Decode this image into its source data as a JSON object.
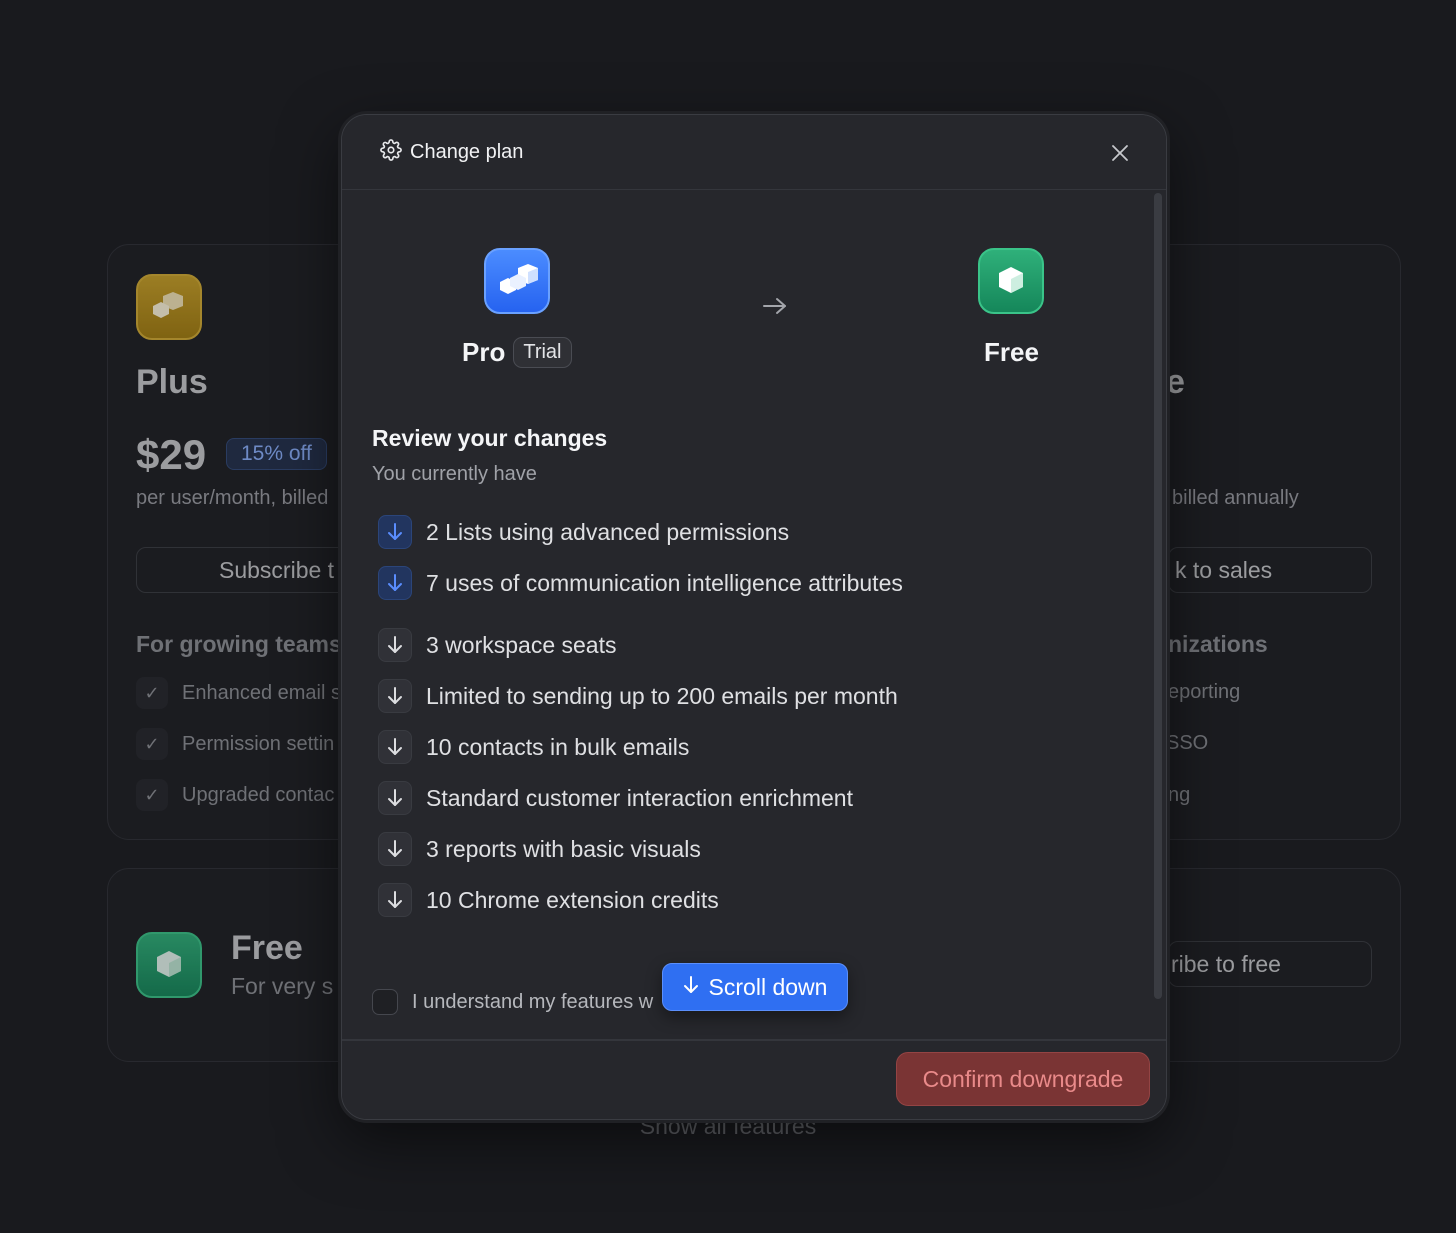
{
  "background": {
    "plus": {
      "title": "Plus",
      "price": "$29",
      "discount": "15% off",
      "per": "per user/month, billed",
      "subscribe_label": "Subscribe t",
      "for_label": "For growing teams",
      "features": [
        "Enhanced email s",
        "Permission settin",
        "Upgraded contac"
      ]
    },
    "right": {
      "title_fragment": "e",
      "billed": "billed annually",
      "sales_label": "k to sales",
      "org_label": "nizations",
      "features": [
        "eporting",
        "SSO",
        "ng"
      ]
    },
    "free": {
      "title": "Free",
      "subtitle": "For very s",
      "button_label": "ribe to free"
    },
    "show_all": "Show all features"
  },
  "modal": {
    "title": "Change plan",
    "from_plan": {
      "name": "Pro",
      "badge": "Trial"
    },
    "to_plan": {
      "name": "Free"
    },
    "review_title": "Review your changes",
    "review_subtitle": "You currently have",
    "changes": [
      {
        "text": "2 Lists using advanced permissions",
        "style": "blue"
      },
      {
        "text": "7 uses of communication intelligence attributes",
        "style": "blue"
      },
      {
        "text": "3 workspace seats",
        "style": "gray"
      },
      {
        "text": "Limited to sending up to 200 emails per month",
        "style": "gray"
      },
      {
        "text": "10 contacts in bulk emails",
        "style": "gray"
      },
      {
        "text": "Standard customer interaction enrichment",
        "style": "gray"
      },
      {
        "text": "3 reports with basic visuals",
        "style": "gray"
      },
      {
        "text": "10 Chrome extension credits",
        "style": "gray"
      }
    ],
    "acknowledge": "I understand my features w",
    "scroll_down_label": "Scroll down",
    "confirm_label": "Confirm downgrade"
  },
  "colors": {
    "accent_blue": "#2f6ff2",
    "danger": "#7a3434",
    "pro_icon": "#2663f0",
    "free_icon": "#15875a",
    "plus_icon": "#a47e10"
  },
  "icons": {
    "header": "gear-icon",
    "close": "close-icon",
    "transition": "arrow-right-icon",
    "change": "arrow-down-icon"
  }
}
